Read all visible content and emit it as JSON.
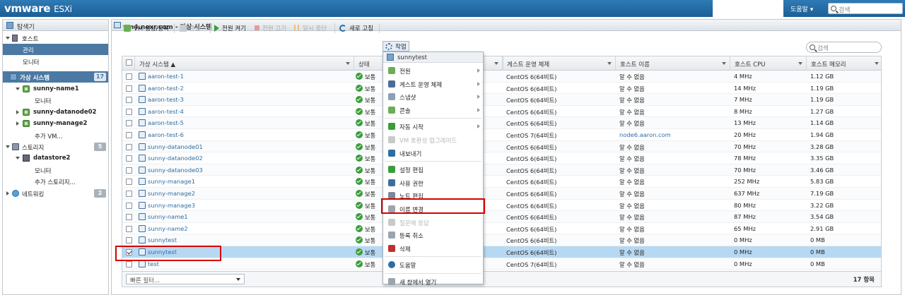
{
  "topbar": {
    "logo_brand": "vmware",
    "logo_product": "ESXi",
    "help_label": "도움말 ▾",
    "search_placeholder": "검색"
  },
  "navigator": {
    "title": "탐색기",
    "items": [
      {
        "label": "호스트"
      },
      {
        "label": "관리"
      },
      {
        "label": "모니터"
      },
      {
        "label": "가상 시스템",
        "badge": "17"
      },
      {
        "label": "sunny-name1"
      },
      {
        "label": "모니터"
      },
      {
        "label": "sunny-datanode02"
      },
      {
        "label": "sunny-manage2"
      },
      {
        "label": "추가 VM..."
      },
      {
        "label": "스토리지",
        "badge": "5"
      },
      {
        "label": "datastore2"
      },
      {
        "label": "모니터"
      },
      {
        "label": "추가 스토리지..."
      },
      {
        "label": "네트워킹",
        "badge": "2"
      }
    ]
  },
  "main": {
    "title": "vm4.nexr.com - 가상 시스템",
    "toolbar": {
      "create": "VM 생성/등록",
      "console": "콘솔",
      "power_on": "전원 켜기",
      "power_off": "전원 끄기",
      "suspend": "일시 중단",
      "refresh": "새로 고침",
      "actions": "작업"
    },
    "search_placeholder": "검색",
    "columns": [
      "가상 시스템 ▲",
      "상태",
      "",
      "게스트 운영 체제",
      "호스트 이름",
      "호스트 CPU",
      "호스트 메모리"
    ],
    "rows": [
      {
        "name": "aaron-test-1",
        "status": "보통",
        "os": "CentOS 6(64비트)",
        "host": "알 수 없음",
        "cpu": "4 MHz",
        "mem": "1.12 GB"
      },
      {
        "name": "aaron-test-2",
        "status": "보통",
        "os": "CentOS 6(64비트)",
        "host": "알 수 없음",
        "cpu": "14 MHz",
        "mem": "1.19 GB"
      },
      {
        "name": "aaron-test-3",
        "status": "보통",
        "os": "CentOS 6(64비트)",
        "host": "알 수 없음",
        "cpu": "7 MHz",
        "mem": "1.19 GB"
      },
      {
        "name": "aaron-test-4",
        "status": "보통",
        "os": "CentOS 6(64비트)",
        "host": "알 수 없음",
        "cpu": "8 MHz",
        "mem": "1.27 GB"
      },
      {
        "name": "aaron-test-5",
        "status": "보통",
        "os": "CentOS 6(64비트)",
        "host": "알 수 없음",
        "cpu": "13 MHz",
        "mem": "1.14 GB"
      },
      {
        "name": "aaron-test-6",
        "status": "보통",
        "os": "CentOS 7(64비트)",
        "host": "node6.aaron.com",
        "cpu": "20 MHz",
        "mem": "1.94 GB"
      },
      {
        "name": "sunny-datanode01",
        "status": "보통",
        "os": "CentOS 6(64비트)",
        "host": "알 수 없음",
        "cpu": "70 MHz",
        "mem": "3.28 GB"
      },
      {
        "name": "sunny-datanode02",
        "status": "보통",
        "os": "CentOS 6(64비트)",
        "host": "알 수 없음",
        "cpu": "78 MHz",
        "mem": "3.35 GB"
      },
      {
        "name": "sunny-datanode03",
        "status": "보통",
        "os": "CentOS 6(64비트)",
        "host": "알 수 없음",
        "cpu": "70 MHz",
        "mem": "3.46 GB"
      },
      {
        "name": "sunny-manage1",
        "status": "보통",
        "os": "CentOS 6(64비트)",
        "host": "알 수 없음",
        "cpu": "252 MHz",
        "mem": "5.83 GB"
      },
      {
        "name": "sunny-manage2",
        "status": "보통",
        "os": "CentOS 6(64비트)",
        "host": "알 수 없음",
        "cpu": "637 MHz",
        "mem": "7.19 GB"
      },
      {
        "name": "sunny-manage3",
        "status": "보통",
        "os": "CentOS 6(64비트)",
        "host": "알 수 없음",
        "cpu": "80 MHz",
        "mem": "3.22 GB"
      },
      {
        "name": "sunny-name1",
        "status": "보통",
        "os": "CentOS 6(64비트)",
        "host": "알 수 없음",
        "cpu": "87 MHz",
        "mem": "3.54 GB"
      },
      {
        "name": "sunny-name2",
        "status": "보통",
        "os": "CentOS 6(64비트)",
        "host": "알 수 없음",
        "cpu": "65 MHz",
        "mem": "2.91 GB"
      },
      {
        "name": "sunnytest",
        "status": "보통",
        "os": "CentOS 6(64비트)",
        "host": "알 수 없음",
        "cpu": "0 MHz",
        "mem": "0 MB"
      },
      {
        "name": "sunnytest",
        "status": "보통",
        "os": "CentOS 6(64비트)",
        "host": "알 수 없음",
        "cpu": "0 MHz",
        "mem": "0 MB",
        "selected": true
      },
      {
        "name": "test",
        "status": "보통",
        "os": "CentOS 7(64비트)",
        "host": "알 수 없음",
        "cpu": "0 MHz",
        "mem": "0 MB"
      }
    ],
    "filter_placeholder": "빠른 필터...",
    "count_label": "17 항목"
  },
  "context_menu": {
    "header": "sunnytest",
    "items": [
      {
        "label": "전원",
        "submenu": true
      },
      {
        "label": "게스트 운영 체제",
        "submenu": true
      },
      {
        "label": "스냅샷",
        "submenu": true
      },
      {
        "label": "콘솔",
        "submenu": true
      },
      {
        "label": "자동 시작",
        "submenu": true
      },
      {
        "label": "VM 호환성 업그레이드",
        "disabled": true
      },
      {
        "label": "내보내기"
      },
      {
        "label": "설정 편집"
      },
      {
        "label": "사용 권한"
      },
      {
        "label": "노트 편집"
      },
      {
        "label": "이름 변경"
      },
      {
        "label": "질문에 응답",
        "disabled": true
      },
      {
        "label": "등록 취소"
      },
      {
        "label": "삭제"
      },
      {
        "label": "도움말"
      },
      {
        "label": "새 창에서 열기"
      }
    ]
  },
  "colors": {
    "topbar": "#1b5f96",
    "nav_selected": "#4b79a3",
    "row_selected": "#b7d8f2",
    "highlight_box": "#d60000",
    "status_ok": "#3a9d3a"
  }
}
